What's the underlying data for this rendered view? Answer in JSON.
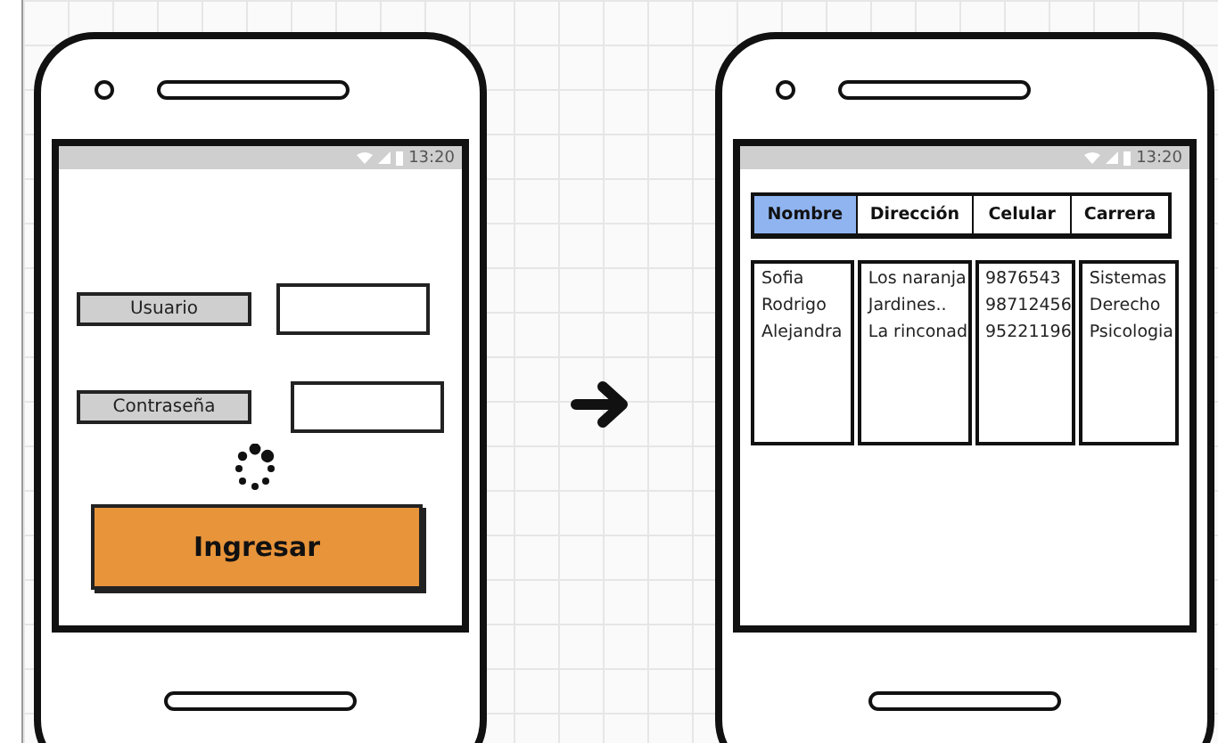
{
  "login_phone": {
    "status_bar": {
      "time": "13:20"
    },
    "fields": [
      {
        "label": "Usuario"
      },
      {
        "label": "Contraseña"
      }
    ],
    "submit_button": "Ingresar"
  },
  "list_phone": {
    "status_bar": {
      "time": "13:20"
    },
    "tabs": [
      {
        "label": "Nombre",
        "selected": true
      },
      {
        "label": "Dirección",
        "selected": false
      },
      {
        "label": "Celular",
        "selected": false
      },
      {
        "label": "Carrera",
        "selected": false
      }
    ],
    "columns": [
      {
        "rows": [
          "Sofia",
          "Rodrigo",
          "Alejandra"
        ]
      },
      {
        "rows": [
          "Los naranja",
          "Jardines..",
          "La rinconad"
        ]
      },
      {
        "rows": [
          "9876543",
          "98712456",
          "95221196"
        ]
      },
      {
        "rows": [
          "Sistemas",
          "Derecho",
          "Psicologia"
        ]
      }
    ]
  }
}
